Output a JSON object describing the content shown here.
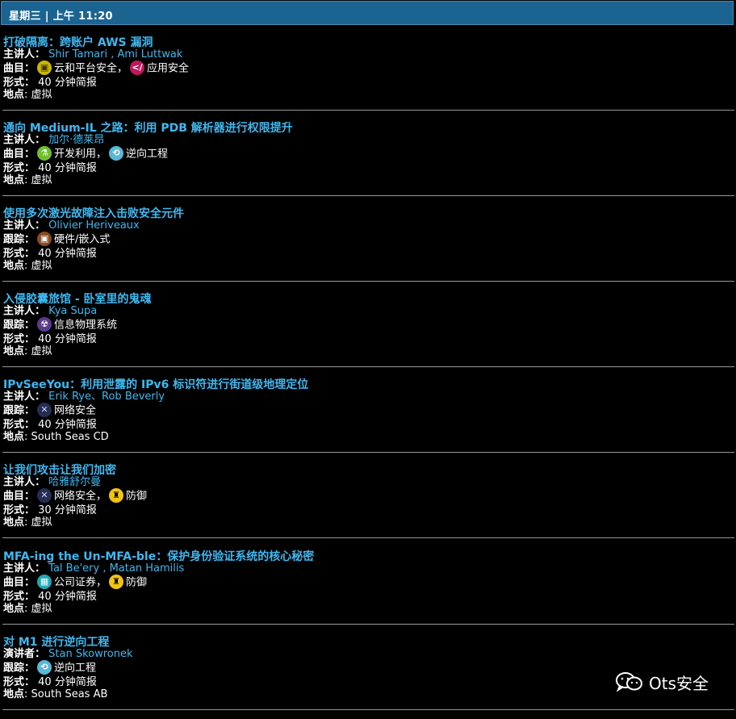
{
  "header": {
    "title": "星期三 | 上午 11:20"
  },
  "sessions": [
    {
      "title": "打破隔离：跨账户 AWS 漏洞",
      "speaker_label": "主讲人：",
      "speakers": [
        "Shir Tamari",
        "Ami Luttwak"
      ],
      "separators": [
        " , "
      ],
      "track_label": "曲目：",
      "tracks": [
        {
          "icon": "cloud",
          "name": "云和平台安全，"
        },
        {
          "icon": "app",
          "name": "应用安全"
        }
      ],
      "format_label": "形式：",
      "format": "40 分钟简报",
      "location_label": "地点",
      "location": ": 虚拟"
    },
    {
      "title": "通向 Medium-IL 之路：利用 PDB 解析器进行权限提升",
      "speaker_label": "主讲人：",
      "speakers": [
        "加尔·德莱昂"
      ],
      "separators": [],
      "track_label": "曲目：",
      "tracks": [
        {
          "icon": "exploit",
          "name": "开发利用，"
        },
        {
          "icon": "reverse",
          "name": "逆向工程"
        }
      ],
      "format_label": "形式：",
      "format": "40 分钟简报",
      "location_label": "地点",
      "location": ": 虚拟"
    },
    {
      "title": "使用多次激光故障注入击败安全元件",
      "speaker_label": "主讲人：",
      "speakers": [
        "Olivier Heriveaux"
      ],
      "separators": [],
      "track_label": "跟踪：",
      "tracks": [
        {
          "icon": "hardware",
          "name": "硬件/嵌入式"
        }
      ],
      "format_label": "形式：",
      "format": "40 分钟简报",
      "location_label": "地点",
      "location": ": 虚拟"
    },
    {
      "title": "入侵胶囊旅馆 - 卧室里的鬼魂",
      "speaker_label": "主讲人：",
      "speakers": [
        "Kya Supa"
      ],
      "separators": [],
      "track_label": "跟踪：",
      "tracks": [
        {
          "icon": "cyber-physical",
          "name": "信息物理系统"
        }
      ],
      "format_label": "形式：",
      "format": "40 分钟简报",
      "location_label": "地点",
      "location": ": 虚拟"
    },
    {
      "title": "IPvSeeYou：利用泄露的 IPv6 标识符进行街道级地理定位",
      "speaker_label": "主讲人：",
      "speakers": [
        "Erik Rye",
        "Rob Beverly"
      ],
      "separators": [
        "、"
      ],
      "track_label": "跟踪：",
      "tracks": [
        {
          "icon": "network",
          "name": "网络安全"
        }
      ],
      "format_label": "形式：",
      "format": "40 分钟简报",
      "location_label": "地点",
      "location": ": South Seas CD"
    },
    {
      "title": "让我们攻击让我们加密",
      "speaker_label": "主讲人：",
      "speakers": [
        "哈雅舒尔曼"
      ],
      "separators": [],
      "track_label": "曲目：",
      "tracks": [
        {
          "icon": "network",
          "name": "网络安全，"
        },
        {
          "icon": "defense",
          "name": "防御"
        }
      ],
      "format_label": "形式：",
      "format": "30 分钟简报",
      "location_label": "地点",
      "location": ": 虚拟"
    },
    {
      "title": "MFA-ing the Un-MFA-ble：保护身份验证系统的核心秘密",
      "speaker_label": "主讲人：",
      "speakers": [
        "Tal Be'ery",
        "Matan Hamilis"
      ],
      "separators": [
        " , "
      ],
      "track_label": "曲目：",
      "tracks": [
        {
          "icon": "corporate",
          "name": "公司证券，"
        },
        {
          "icon": "defense",
          "name": "防御"
        }
      ],
      "format_label": "形式：",
      "format": "40 分钟简报",
      "location_label": "地点",
      "location": ": 虚拟"
    },
    {
      "title": "对 M1 进行逆向工程",
      "speaker_label": "演讲者：",
      "speakers": [
        "Stan Skowronek"
      ],
      "separators": [],
      "track_label": "跟踪：",
      "tracks": [
        {
          "icon": "reverse",
          "name": "逆向工程"
        }
      ],
      "format_label": "形式：",
      "format": "40 分钟简报",
      "location_label": "地点",
      "location": ": South Seas AB"
    }
  ],
  "watermark": {
    "text": "Ots安全",
    "icon": "wechat-icon"
  }
}
